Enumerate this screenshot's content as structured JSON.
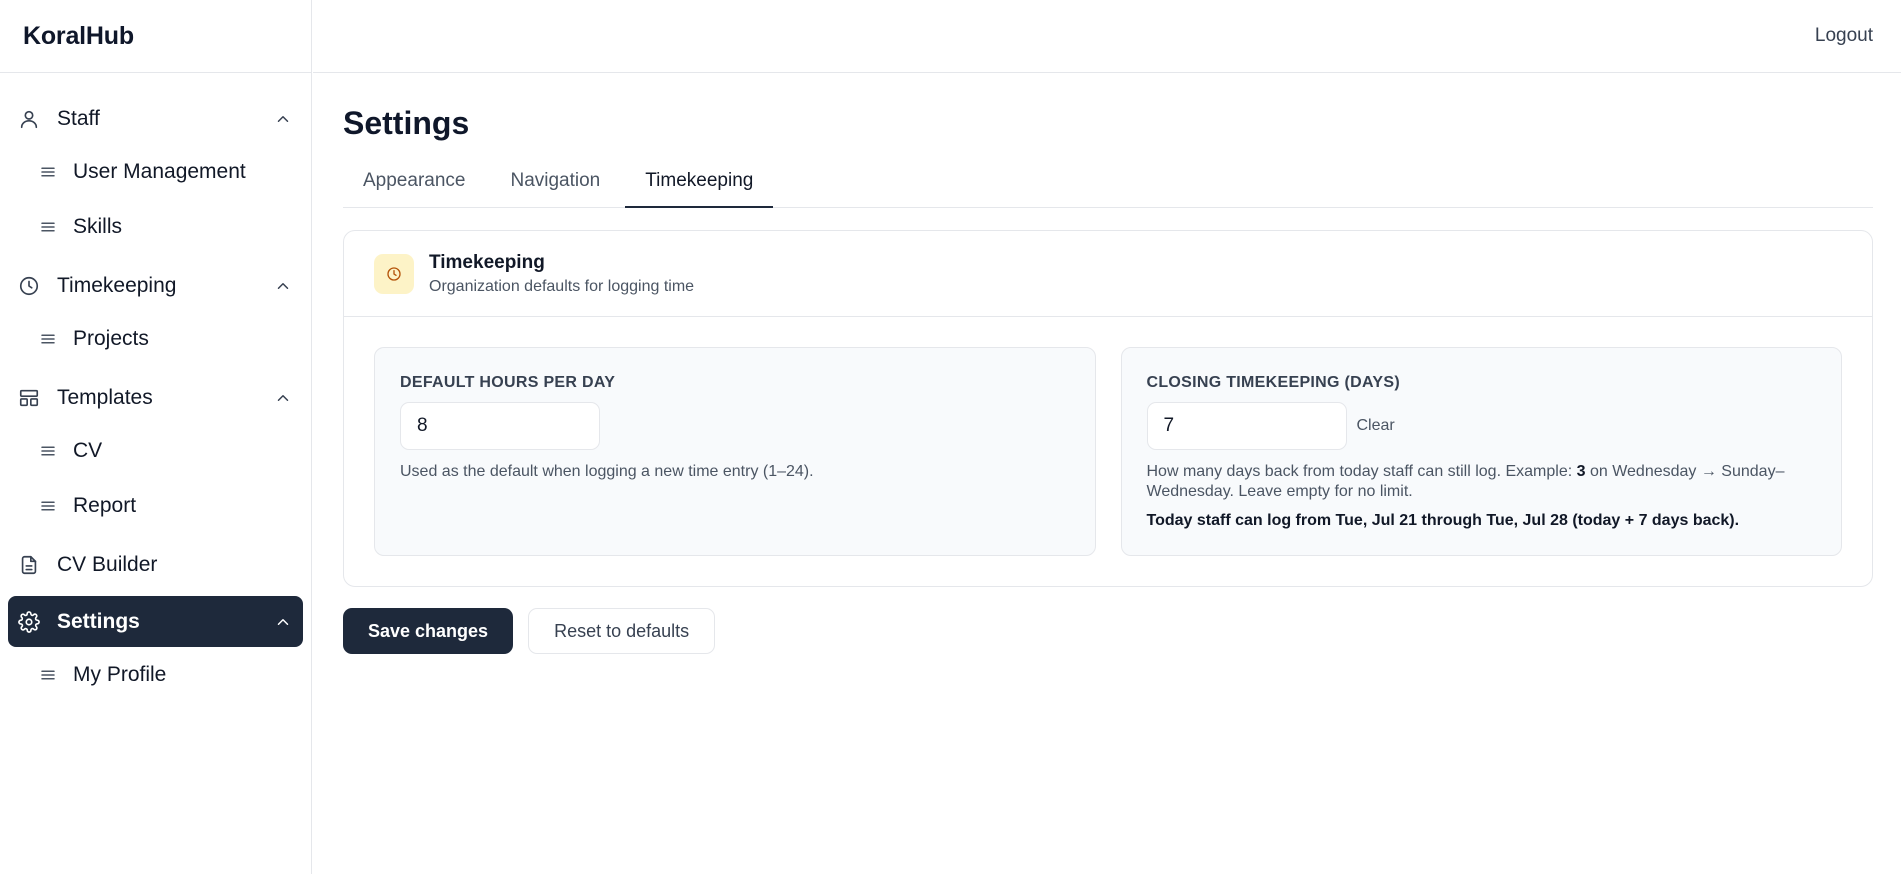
{
  "app": {
    "brand": "KoralHub"
  },
  "topbar": {
    "logout_label": "Logout"
  },
  "sidebar": {
    "groups": [
      {
        "label": "Staff",
        "icon": "user-icon",
        "expanded": true,
        "items": [
          {
            "label": "User Management"
          },
          {
            "label": "Skills"
          }
        ]
      },
      {
        "label": "Timekeeping",
        "icon": "clock-icon",
        "expanded": true,
        "items": [
          {
            "label": "Projects"
          }
        ]
      },
      {
        "label": "Templates",
        "icon": "layout-icon",
        "expanded": true,
        "items": [
          {
            "label": "CV"
          },
          {
            "label": "Report"
          }
        ]
      },
      {
        "label": "CV Builder",
        "icon": "file-icon"
      },
      {
        "label": "Settings",
        "icon": "gear-icon",
        "expanded": true,
        "active": true,
        "items": [
          {
            "label": "My Profile"
          }
        ]
      }
    ]
  },
  "page": {
    "title": "Settings"
  },
  "tabs": [
    {
      "label": "Appearance"
    },
    {
      "label": "Navigation"
    },
    {
      "label": "Timekeeping",
      "active": true
    }
  ],
  "card": {
    "title": "Timekeeping",
    "subtitle": "Organization defaults for logging time",
    "default_hours": {
      "label": "DEFAULT HOURS PER DAY",
      "value": "8",
      "help": "Used as the default when logging a new time entry (1–24)."
    },
    "closing": {
      "label": "CLOSING TIMEKEEPING (DAYS)",
      "value": "7",
      "clear_label": "Clear",
      "help_prefix": "How many days back from today staff can still log. Example: ",
      "help_example_value": "3",
      "help_suffix": " on Wednesday → Sunday–Wednesday. Leave empty for no limit.",
      "note": "Today staff can log from Tue, Jul 21 through Tue, Jul 28 (today + 7 days back)."
    }
  },
  "actions": {
    "save_label": "Save changes",
    "reset_label": "Reset to defaults"
  },
  "colors": {
    "active_nav_bg": "#1e293b",
    "primary_button": "#1e293b",
    "clock_badge_bg": "#fdf3c7"
  }
}
